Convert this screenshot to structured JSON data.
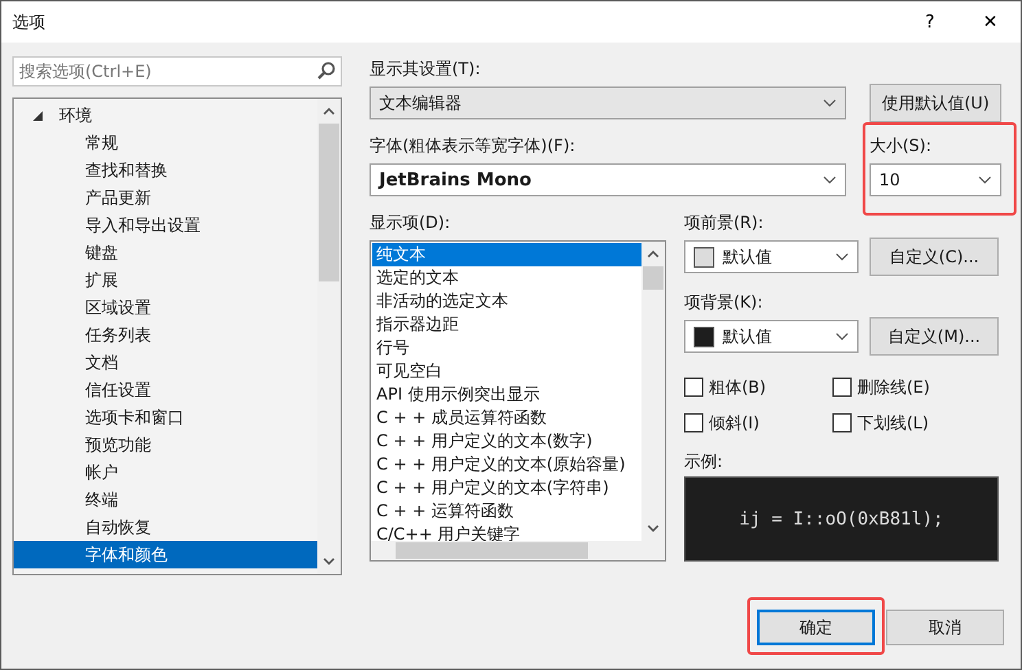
{
  "window": {
    "title": "选项",
    "buttons": [
      "?",
      "✕"
    ]
  },
  "search": {
    "placeholder": "搜索选项(Ctrl+E)"
  },
  "tree": [
    {
      "label": "环境",
      "expanded": true,
      "selected": false,
      "children": [
        {
          "label": "常规",
          "selected": false
        },
        {
          "label": "查找和替换",
          "selected": false
        },
        {
          "label": "产品更新",
          "selected": false
        },
        {
          "label": "导入和导出设置",
          "selected": false
        },
        {
          "label": "键盘",
          "selected": false
        },
        {
          "label": "扩展",
          "selected": false
        },
        {
          "label": "区域设置",
          "selected": false
        },
        {
          "label": "任务列表",
          "selected": false
        },
        {
          "label": "文档",
          "selected": false
        },
        {
          "label": "信任设置",
          "selected": false
        },
        {
          "label": "选项卡和窗口",
          "selected": false
        },
        {
          "label": "预览功能",
          "selected": false
        },
        {
          "label": "帐户",
          "selected": false
        },
        {
          "label": "终端",
          "selected": false
        },
        {
          "label": "自动恢复",
          "selected": false
        },
        {
          "label": "字体和颜色",
          "selected": true
        }
      ]
    }
  ],
  "settings_for": {
    "label": "显示其设置(T):",
    "value": "文本编辑器"
  },
  "use_defaults_button": "使用默认值(U)",
  "font": {
    "label": "字体(粗体表示等宽字体)(F):",
    "value": "JetBrains Mono"
  },
  "size": {
    "label": "大小(S):",
    "value": "10",
    "highlighted": true
  },
  "display_items": {
    "label": "显示项(D):",
    "items": [
      {
        "label": "纯文本",
        "selected": true
      },
      {
        "label": "选定的文本",
        "selected": false
      },
      {
        "label": "非活动的选定文本",
        "selected": false
      },
      {
        "label": "指示器边距",
        "selected": false
      },
      {
        "label": "行号",
        "selected": false
      },
      {
        "label": "可见空白",
        "selected": false
      },
      {
        "label": "API 使用示例突出显示",
        "selected": false
      },
      {
        "label": "C + + 成员运算符函数",
        "selected": false
      },
      {
        "label": "C + + 用户定义的文本(数字)",
        "selected": false
      },
      {
        "label": "C + + 用户定义的文本(原始容量)",
        "selected": false
      },
      {
        "label": "C + + 用户定义的文本(字符串)",
        "selected": false
      },
      {
        "label": "C + + 运算符函数",
        "selected": false
      },
      {
        "label": "C/C++ 用户关键字",
        "selected": false
      }
    ]
  },
  "color_pickers": [
    {
      "label": "项前景(R):",
      "value": "默认值",
      "color": "#dcdcdc",
      "button": "自定义(C)..."
    },
    {
      "label": "项背景(K):",
      "value": "默认值",
      "color": "#1e1e1e",
      "button": "自定义(M)..."
    }
  ],
  "checkboxes": [
    {
      "label": "粗体(B)",
      "checked": false
    },
    {
      "label": "删除线(E)",
      "checked": false
    },
    {
      "label": "倾斜(I)",
      "checked": false
    },
    {
      "label": "下划线(L)",
      "checked": false
    }
  ],
  "sample": {
    "label": "示例:",
    "text": "ij = I::oO(0xB81l);"
  },
  "buttons": [
    {
      "label": "确定",
      "default": true,
      "highlighted": true
    },
    {
      "label": "取消",
      "default": false,
      "highlighted": false
    }
  ]
}
